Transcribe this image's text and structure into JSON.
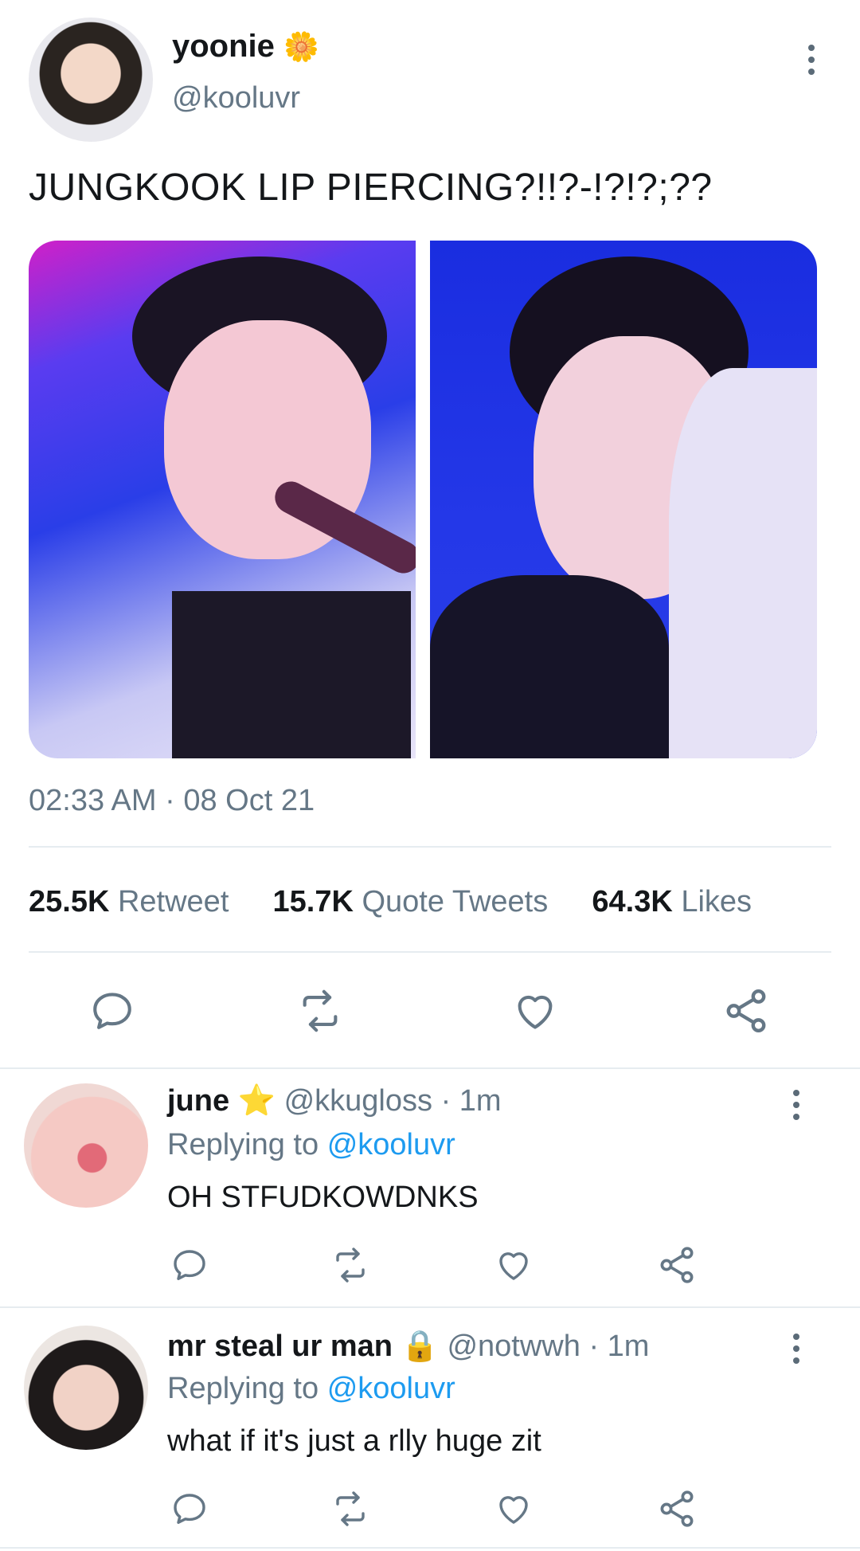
{
  "tweet": {
    "author_name": "yoonie",
    "author_emoji": "🌼",
    "author_handle": "@kooluvr",
    "text": "JUNGKOOK LIP PIERCING?!!?-!?!?;??",
    "timestamp": "02:33 AM · 08 Oct 21",
    "stats": {
      "retweet_count": "25.5K",
      "retweet_label": "Retweet",
      "quote_count": "15.7K",
      "quote_label": "Quote Tweets",
      "likes_count": "64.3K",
      "likes_label": "Likes"
    }
  },
  "replies": [
    {
      "name": "june",
      "badge": "⭐",
      "handle": "@kkugloss",
      "time": "· 1m",
      "replying_prefix": "Replying to",
      "replying_to": "@kooluvr",
      "text": "OH STFUDKOWDNKS"
    },
    {
      "name": "mr steal ur man",
      "badge": "🔒",
      "handle": "@notwwh",
      "time": "· 1m",
      "replying_prefix": "Replying to",
      "replying_to": "@kooluvr",
      "text": "what if it's just a rlly huge zit"
    }
  ],
  "colors": {
    "accent": "#1d9bf0",
    "muted_text": "#657786",
    "divider": "#e6ecf0",
    "photo_backdrop": "#1f3ae0"
  },
  "icons": [
    "reply-icon",
    "retweet-icon",
    "like-icon",
    "share-icon",
    "more-icon"
  ]
}
